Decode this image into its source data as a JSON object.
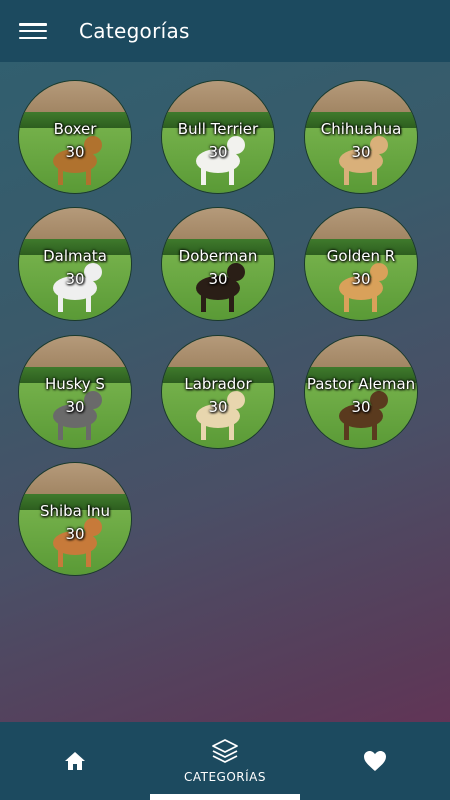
{
  "appbar": {
    "title": "Categorías",
    "menu_icon": "menu-icon"
  },
  "categories": [
    {
      "name": "Boxer",
      "count": "30",
      "dog_color": "#b0722e"
    },
    {
      "name": "Bull Terrier",
      "count": "30",
      "dog_color": "#f2f2ee"
    },
    {
      "name": "Chihuahua",
      "count": "30",
      "dog_color": "#d9b07a"
    },
    {
      "name": "Dalmata",
      "count": "30",
      "dog_color": "#efefef"
    },
    {
      "name": "Doberman",
      "count": "30",
      "dog_color": "#2a1e16"
    },
    {
      "name": "Golden R",
      "count": "30",
      "dog_color": "#d9a15a"
    },
    {
      "name": "Husky S",
      "count": "30",
      "dog_color": "#6a6a6a"
    },
    {
      "name": "Labrador",
      "count": "30",
      "dog_color": "#e8d6ae"
    },
    {
      "name": "Pastor Aleman",
      "count": "30",
      "dog_color": "#5a3a1e"
    },
    {
      "name": "Shiba Inu",
      "count": "30",
      "dog_color": "#c77a3a"
    }
  ],
  "bottomnav": {
    "items": [
      {
        "icon": "home-icon",
        "label": ""
      },
      {
        "icon": "layers-icon",
        "label": "CATEGORÍAS"
      },
      {
        "icon": "heart-icon",
        "label": ""
      }
    ]
  },
  "colors": {
    "bar": "#1c4a5f",
    "accent": "#ffffff"
  }
}
